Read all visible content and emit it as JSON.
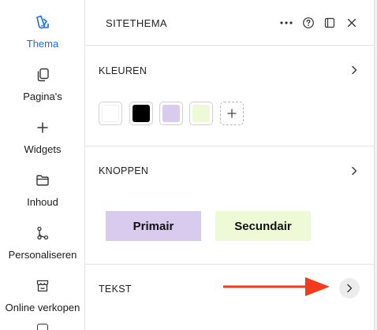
{
  "sidebar": {
    "items": [
      {
        "label": "Thema",
        "icon": "theme-icon",
        "active": true
      },
      {
        "label": "Pagina's",
        "icon": "pages-icon",
        "active": false
      },
      {
        "label": "Widgets",
        "icon": "plus-icon",
        "active": false
      },
      {
        "label": "Inhoud",
        "icon": "folder-icon",
        "active": false
      },
      {
        "label": "Personaliseren",
        "icon": "branch-icon",
        "active": false
      },
      {
        "label": "Online verkopen",
        "icon": "store-icon",
        "active": false
      }
    ],
    "accent": "#116dff"
  },
  "panel": {
    "title": "SITETHEMA",
    "header_icons": [
      "more-icon",
      "help-icon",
      "dock-icon",
      "close-icon"
    ],
    "colors": {
      "title": "KLEUREN",
      "swatches": [
        "#ffffff",
        "#000000",
        "#d9cbee",
        "#eefad6"
      ]
    },
    "buttons": {
      "title": "KNOPPEN",
      "primary_label": "Primair",
      "primary_color": "#d9cbee",
      "secondary_label": "Secundair",
      "secondary_color": "#eefad6"
    },
    "text": {
      "title": "TEKST"
    }
  },
  "annotation": {
    "arrow_color": "#f23a1d"
  }
}
